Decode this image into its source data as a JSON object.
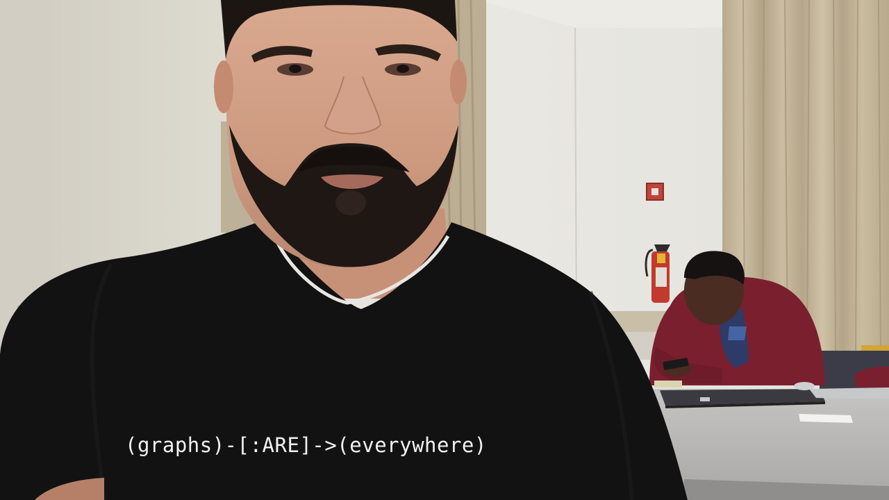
{
  "photo": {
    "shirt_slogan": "(graphs)-[:ARE]->(everywhere)"
  },
  "colors": {
    "wall": "#e7e6df",
    "curtain": "#c6b79b",
    "shirt": "#121212",
    "hoodie": "#7a1f2e",
    "table": "#b9b8b6",
    "extinguisher": "#c23a2e"
  }
}
